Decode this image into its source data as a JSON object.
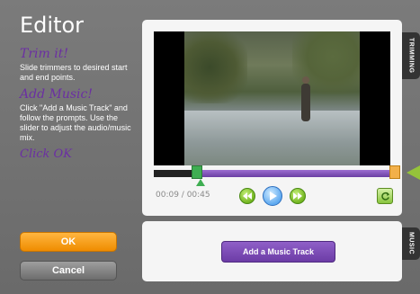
{
  "sidebar": {
    "title": "Editor",
    "trim": {
      "heading": "Trim it!",
      "text": "Slide trimmers to desired start and end points."
    },
    "music": {
      "heading": "Add Music!",
      "text": "Click \"Add a Music Track\" and follow the prompts. Use the slider to adjust the audio/music mix."
    },
    "click_ok": "Click OK",
    "ok_label": "OK",
    "cancel_label": "Cancel"
  },
  "trimming": {
    "tab_label": "TRIMMING",
    "time": "00:09 / 00:45",
    "trim_start_fraction": 0.18,
    "trim_end_fraction": 1.0
  },
  "controls": {
    "rewind_icon": "rewind-icon",
    "play_icon": "play-icon",
    "forward_icon": "fast-forward-icon",
    "refresh_icon": "refresh-icon"
  },
  "music": {
    "tab_label": "MUSIC",
    "add_button": "Add a Music Track"
  },
  "colors": {
    "accent_purple": "#6b3fa3",
    "ok_orange": "#ef8c00",
    "trim_green": "#3fae52",
    "trim_orange": "#f2b04a"
  }
}
